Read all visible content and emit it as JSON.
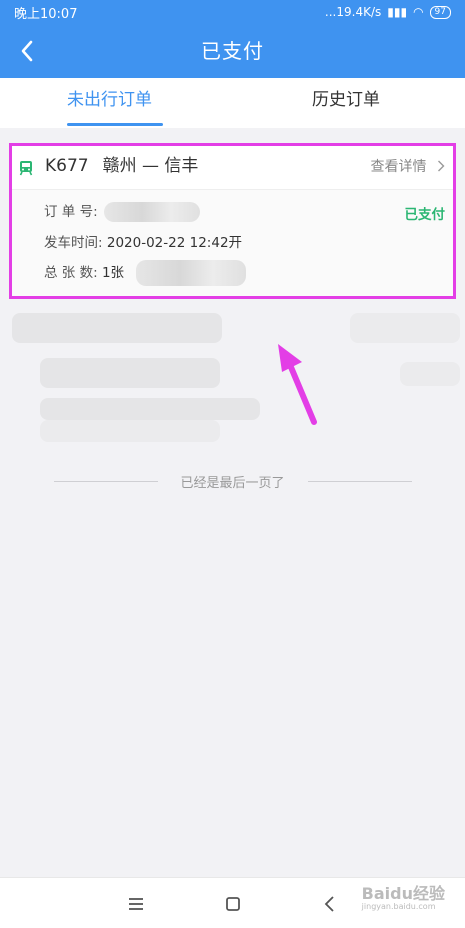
{
  "status_bar": {
    "time": "晚上10:07",
    "network_speed": "...19.4K/s",
    "battery": "97"
  },
  "header": {
    "title": "已支付",
    "back_icon": "chevron-left-icon"
  },
  "tabs": [
    {
      "label": "未出行订单",
      "active": true
    },
    {
      "label": "历史订单",
      "active": false
    }
  ],
  "order": {
    "train_no": "K677",
    "from": "赣州",
    "separator": "—",
    "to": "信丰",
    "details_label": "查看详情",
    "order_no_label": "订 单 号:",
    "depart_label": "发车时间:",
    "depart_date": "2020-02-22",
    "depart_time": "12:42开",
    "count_label": "总 张 数:",
    "count_value": "1张",
    "status": "已支付"
  },
  "footer_text": "已经是最后一页了",
  "watermark": {
    "main": "Baidu经验",
    "sub": "jingyan.baidu.com"
  },
  "colors": {
    "accent": "#3f93f0",
    "paid": "#2bb673",
    "highlight": "#e33ee6"
  }
}
